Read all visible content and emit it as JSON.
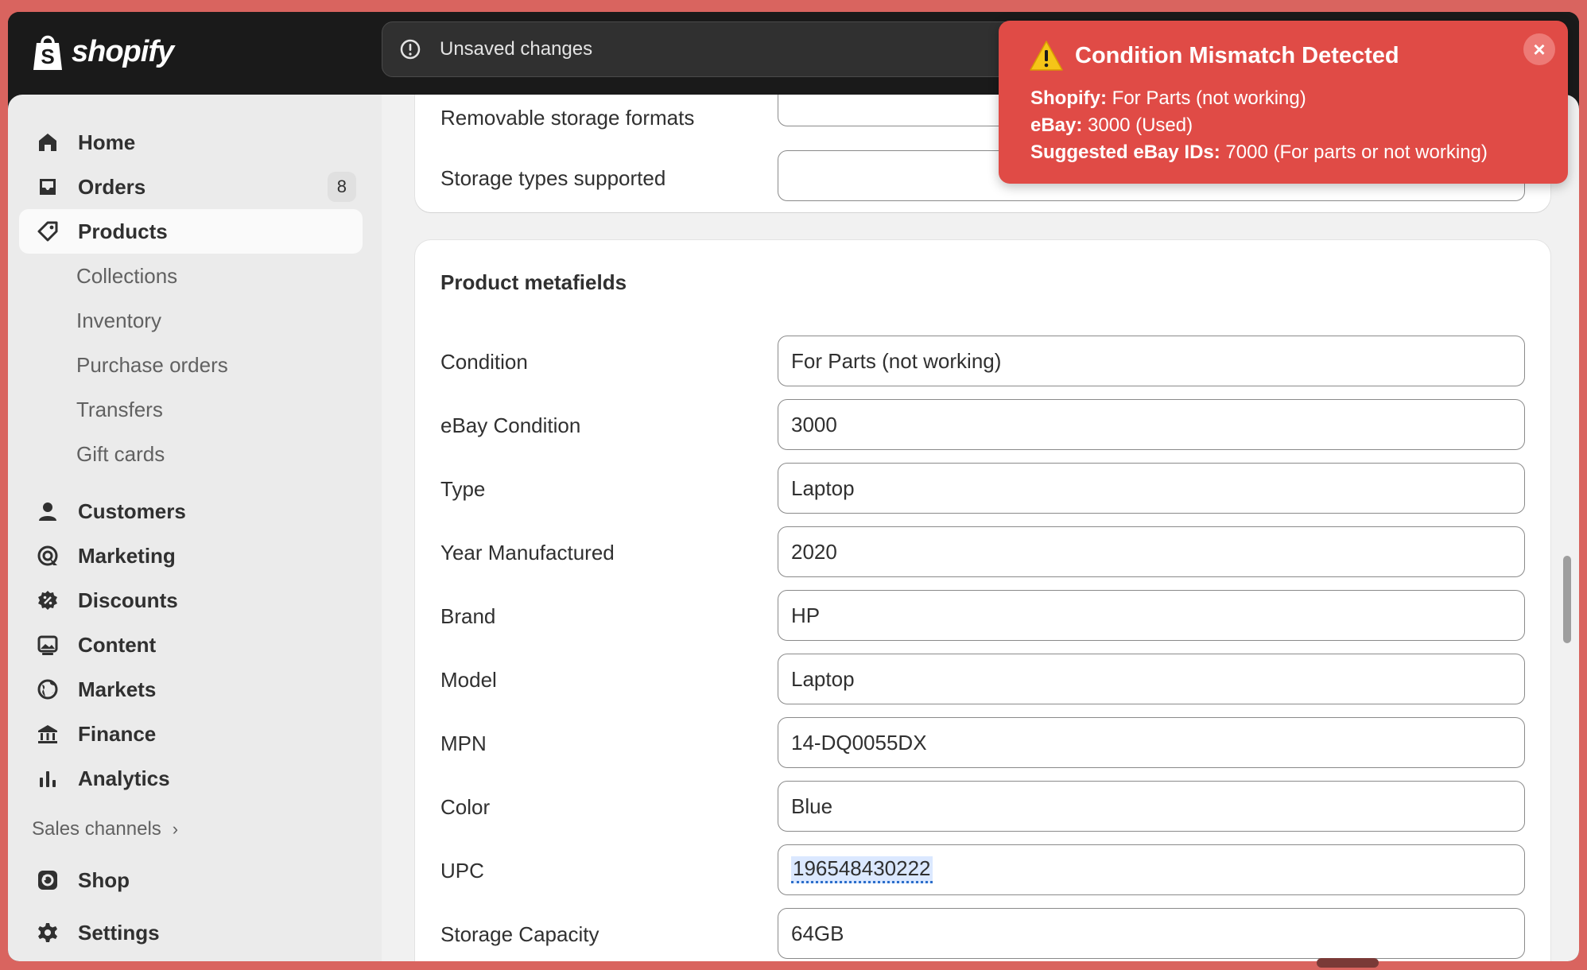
{
  "app": {
    "logo_text": "shopify"
  },
  "topbar": {
    "unsaved_text": "Unsaved changes"
  },
  "sidebar": {
    "items": [
      {
        "label": "Home",
        "icon": "home-icon"
      },
      {
        "label": "Orders",
        "icon": "inbox-icon",
        "badge": "8"
      },
      {
        "label": "Products",
        "icon": "tag-icon",
        "active": true
      }
    ],
    "product_subitems": [
      "Collections",
      "Inventory",
      "Purchase orders",
      "Transfers",
      "Gift cards"
    ],
    "items2": [
      {
        "label": "Customers",
        "icon": "person-icon"
      },
      {
        "label": "Marketing",
        "icon": "target-icon"
      },
      {
        "label": "Discounts",
        "icon": "discount-icon"
      },
      {
        "label": "Content",
        "icon": "image-icon"
      },
      {
        "label": "Markets",
        "icon": "globe-icon"
      },
      {
        "label": "Finance",
        "icon": "bank-icon"
      },
      {
        "label": "Analytics",
        "icon": "bar-chart-icon"
      }
    ],
    "sales_channels_label": "Sales channels",
    "shop_label": "Shop",
    "settings_label": "Settings"
  },
  "top_card": {
    "partial_label": "Removable storage formats",
    "storage_types_label": "Storage types supported",
    "storage_types_value": ""
  },
  "metafields": {
    "title": "Product metafields",
    "fields": [
      {
        "label": "Condition",
        "value": "For Parts (not working)"
      },
      {
        "label": "eBay Condition",
        "value": "3000"
      },
      {
        "label": "Type",
        "value": "Laptop"
      },
      {
        "label": "Year Manufactured",
        "value": "2020"
      },
      {
        "label": "Brand",
        "value": "HP"
      },
      {
        "label": "Model",
        "value": "Laptop"
      },
      {
        "label": "MPN",
        "value": "14-DQ0055DX"
      },
      {
        "label": "Color",
        "value": "Blue"
      },
      {
        "label": "UPC",
        "value": "196548430222"
      },
      {
        "label": "Storage Capacity",
        "value": "64GB"
      }
    ]
  },
  "toast": {
    "title": "Condition Mismatch Detected",
    "shopify_label": "Shopify:",
    "shopify_value": " For Parts (not working)",
    "ebay_label": "eBay:",
    "ebay_value": " 3000 (Used)",
    "suggested_label": "Suggested eBay IDs:",
    "suggested_value": " 7000 (For parts or not working)",
    "close_glyph": "×",
    "bg_color": "#e04b46"
  }
}
